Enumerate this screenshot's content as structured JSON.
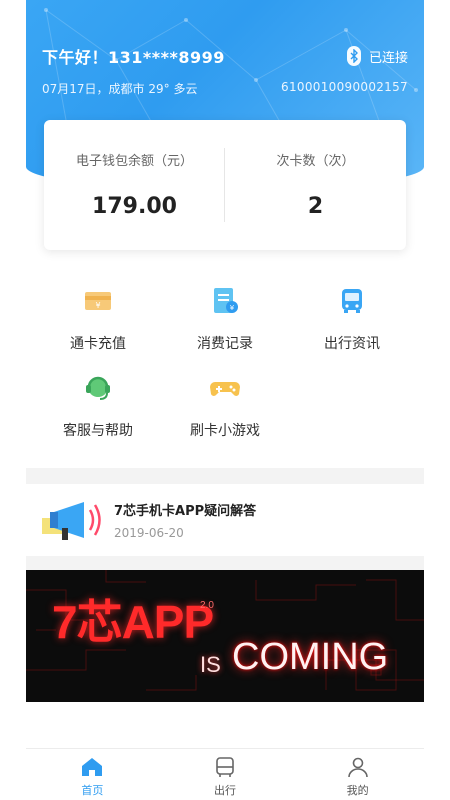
{
  "header": {
    "greeting": "下午好！131****8999",
    "bluetooth_status": "已连接",
    "weather": "07月17日，成都市 29° 多云",
    "card_number": "6100010090002157"
  },
  "balance_card": {
    "wallet_label": "电子钱包余额（元）",
    "wallet_value": "179.00",
    "count_label": "次卡数（次）",
    "count_value": "2"
  },
  "features": [
    {
      "label": "通卡充值",
      "icon": "card-recharge-icon"
    },
    {
      "label": "消费记录",
      "icon": "record-icon"
    },
    {
      "label": "出行资讯",
      "icon": "bus-icon"
    },
    {
      "label": "客服与帮助",
      "icon": "headset-icon"
    },
    {
      "label": "刷卡小游戏",
      "icon": "gamepad-icon"
    }
  ],
  "news": {
    "title": "7芯手机卡APP疑问解答",
    "date": "2019-06-20",
    "icon": "megaphone-icon"
  },
  "banner": {
    "main": "7芯APP",
    "version": "2.0",
    "is": "IS",
    "coming": "COMING"
  },
  "tabbar": {
    "tabs": [
      {
        "label": "首页",
        "icon": "home-icon",
        "active": true
      },
      {
        "label": "出行",
        "icon": "bus-front-icon",
        "active": false
      },
      {
        "label": "我的",
        "icon": "person-icon",
        "active": false
      }
    ]
  },
  "colors": {
    "primary": "#2f9cf0",
    "banner_red": "#ff2a2a"
  }
}
